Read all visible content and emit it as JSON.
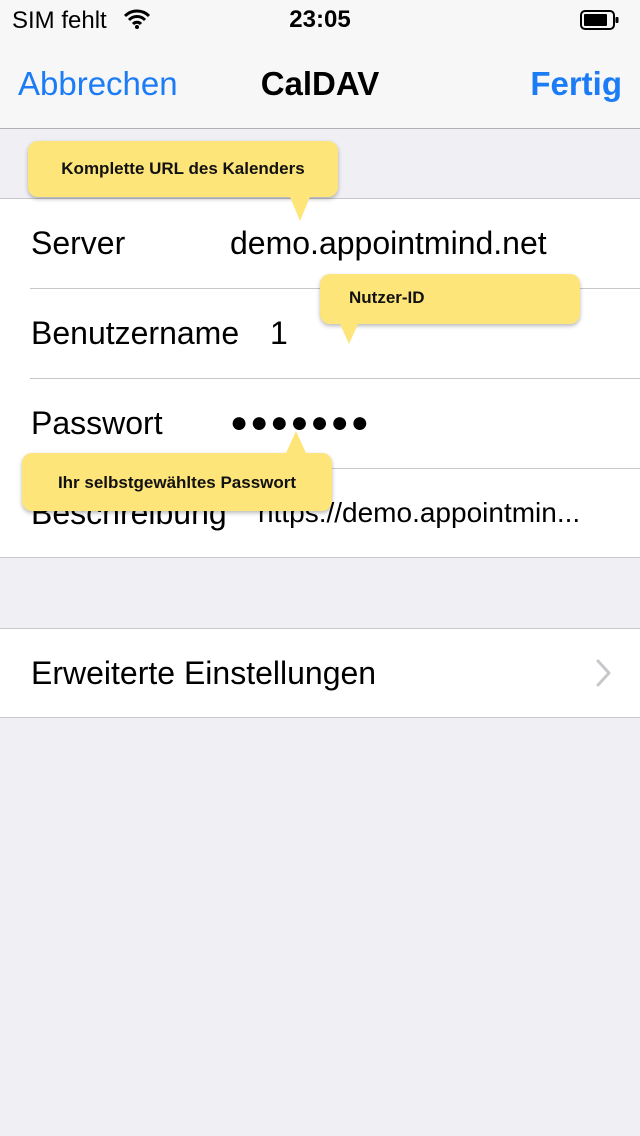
{
  "status_bar": {
    "carrier": "SIM fehlt",
    "time": "23:05",
    "wifi_icon": "wifi-icon",
    "battery_icon": "battery-icon"
  },
  "nav": {
    "cancel_label": "Abbrechen",
    "title": "CalDAV",
    "done_label": "Fertig"
  },
  "form": {
    "rows": [
      {
        "label": "Server",
        "value": "demo.appointmind.net"
      },
      {
        "label": "Benutzername",
        "value": "1"
      },
      {
        "label": "Passwort",
        "value": "●●●●●●●"
      },
      {
        "label": "Beschreibung",
        "value": "https://demo.appointmin..."
      }
    ]
  },
  "advanced": {
    "label": "Erweiterte Einstellungen",
    "chevron_icon": "chevron-right-icon"
  },
  "callouts": {
    "server_hint": "Komplette URL des Kalenders",
    "username_hint": "Nutzer-ID",
    "password_hint": "Ihr selbstgewähltes Passwort"
  },
  "colors": {
    "accent": "#1b7cf6",
    "background": "#efeff4",
    "callout": "#fde57a"
  }
}
